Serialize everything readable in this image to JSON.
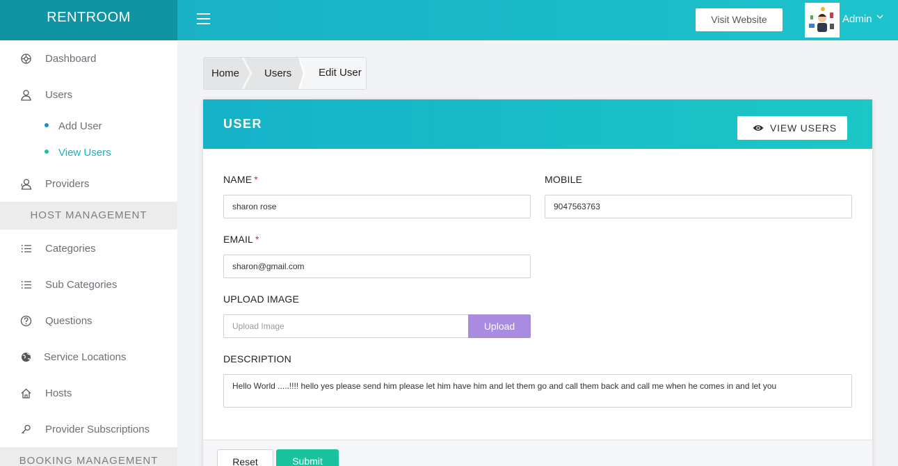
{
  "brand": "RENTROOM",
  "header": {
    "visit_website": "Visit Website",
    "admin_label": "Admin",
    "icons": [
      "menu-icon",
      "avatar",
      "chevron-down-icon"
    ]
  },
  "sidebar": {
    "items": [
      {
        "label": "Dashboard",
        "icon": "dashboard-icon"
      },
      {
        "label": "Users",
        "icon": "user-icon"
      },
      {
        "label": "Providers",
        "icon": "provider-icon"
      }
    ],
    "sub_items": [
      {
        "label": "Add User"
      },
      {
        "label": "View Users",
        "active": true
      }
    ],
    "host_section": "HOST MANAGEMENT",
    "host_items": [
      {
        "label": "Categories",
        "icon": "list-icon"
      },
      {
        "label": "Sub Categories",
        "icon": "list-icon"
      },
      {
        "label": "Questions",
        "icon": "question-icon"
      },
      {
        "label": "Service Locations",
        "icon": "globe-icon"
      },
      {
        "label": "Hosts",
        "icon": "home-icon"
      },
      {
        "label": "Provider Subscriptions",
        "icon": "key-icon"
      }
    ],
    "booking_section": "BOOKING MANAGEMENT"
  },
  "breadcrumb": [
    "Home",
    "Users",
    "Edit User"
  ],
  "card": {
    "title": "USER",
    "view_users": "VIEW USERS"
  },
  "form": {
    "name_label": "NAME",
    "name_value": "sharon rose",
    "mobile_label": "MOBILE",
    "mobile_value": "9047563763",
    "email_label": "EMAIL",
    "email_value": "sharon@gmail.com",
    "required_mark": "*",
    "upload_label": "UPLOAD IMAGE",
    "upload_placeholder": "Upload Image",
    "upload_button": "Upload",
    "description_label": "DESCRIPTION",
    "description_value": "Hello World .....!!!! hello yes please send him please let him have him and let them go and call them back and call me when he comes in and let you",
    "reset_button": "Reset",
    "submit_button": "Submit"
  },
  "colors": {
    "brand_bg": "#1093a3",
    "header_gradient": [
      "#1ab1c6",
      "#1cc3cc"
    ],
    "active_link": "#1aaebf",
    "upload_button": "#a98bdf",
    "submit_button": "#1bc39d",
    "required": "#d9232d"
  }
}
